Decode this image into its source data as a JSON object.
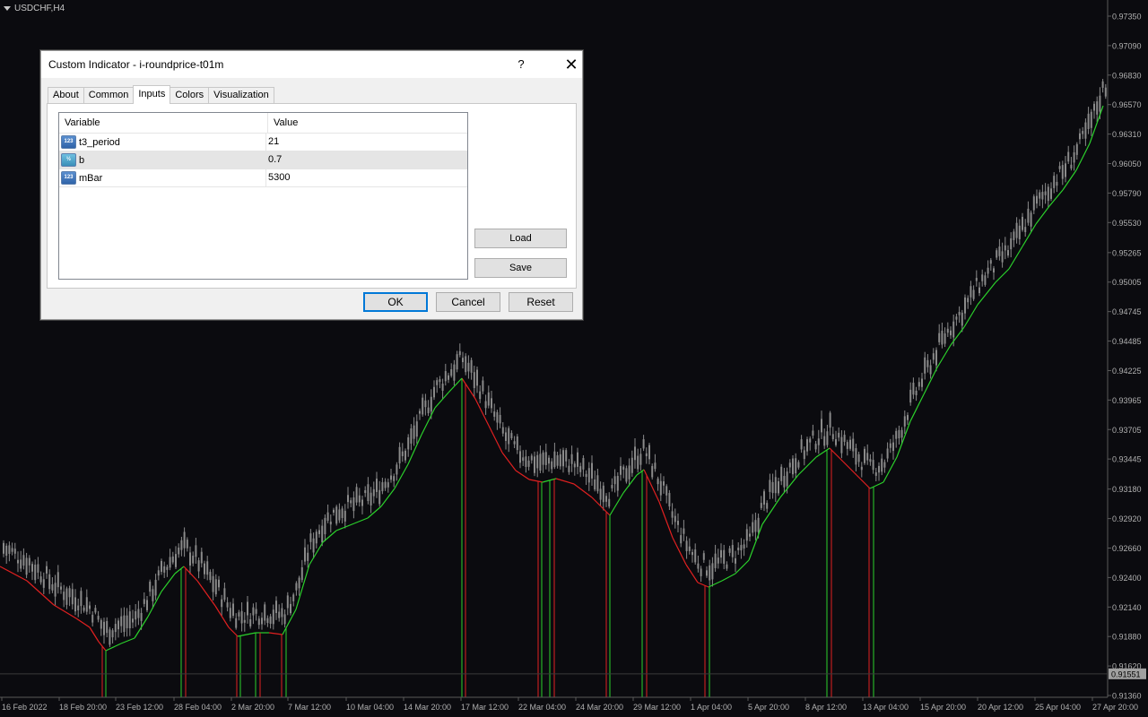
{
  "chart_header": {
    "symbol": "USDCHF,H4"
  },
  "price_axis": {
    "ticks": [
      "0.97350",
      "0.97090",
      "0.96830",
      "0.96570",
      "0.96310",
      "0.96050",
      "0.95790",
      "0.95530",
      "0.95265",
      "0.95005",
      "0.94745",
      "0.94485",
      "0.94225",
      "0.93965",
      "0.93705",
      "0.93445",
      "0.93180",
      "0.92920",
      "0.92660",
      "0.92400",
      "0.92140",
      "0.91880",
      "0.91620",
      "0.91360"
    ],
    "current_price": "0.91551",
    "current_price_color": "#a0a0a0"
  },
  "time_axis": {
    "labels": [
      "16 Feb 2022",
      "18 Feb 20:00",
      "23 Feb 12:00",
      "28 Feb 04:00",
      "2 Mar 20:00",
      "7 Mar 12:00",
      "10 Mar 04:00",
      "14 Mar 20:00",
      "17 Mar 12:00",
      "22 Mar 04:00",
      "24 Mar 20:00",
      "29 Mar 12:00",
      "1 Apr 04:00",
      "5 Apr 20:00",
      "8 Apr 12:00",
      "13 Apr 04:00",
      "15 Apr 20:00",
      "20 Apr 12:00",
      "25 Apr 04:00",
      "27 Apr 20:00"
    ]
  },
  "colors": {
    "background": "#0b0b0f",
    "candles": "#8a8a8a",
    "up_line": "#2bd12b",
    "down_line": "#e02020",
    "axis_text": "#b0b0b0"
  },
  "dialog": {
    "title": "Custom Indicator - i-roundprice-t01m",
    "help_label": "?",
    "close_label": "✕",
    "tabs": [
      {
        "label": "About",
        "active": false
      },
      {
        "label": "Common",
        "active": false
      },
      {
        "label": "Inputs",
        "active": true
      },
      {
        "label": "Colors",
        "active": false
      },
      {
        "label": "Visualization",
        "active": false
      }
    ],
    "table": {
      "headers": {
        "variable": "Variable",
        "value": "Value"
      },
      "rows": [
        {
          "icon": "int-param-icon",
          "icon_text": "123",
          "variable": "t3_period",
          "value": "21"
        },
        {
          "icon": "double-param-icon",
          "icon_text": "½",
          "variable": "b",
          "value": "0.7"
        },
        {
          "icon": "int-param-icon",
          "icon_text": "123",
          "variable": "mBar",
          "value": "5300"
        }
      ]
    },
    "load_label": "Load",
    "save_label": "Save",
    "ok_label": "OK",
    "cancel_label": "Cancel",
    "reset_label": "Reset"
  }
}
